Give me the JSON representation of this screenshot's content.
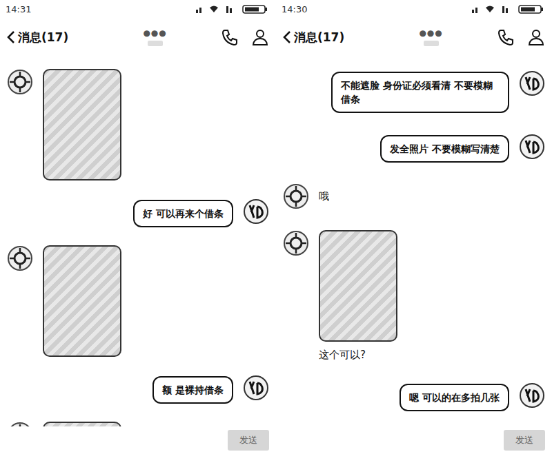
{
  "panels": [
    {
      "status_time": "14:31",
      "header": {
        "back": "消息(17)",
        "title": "●●●"
      },
      "messages": [
        {
          "side": "in",
          "kind": "image",
          "text": ""
        },
        {
          "side": "out",
          "kind": "text",
          "text": "好 可以再来个借条"
        },
        {
          "side": "in",
          "kind": "image",
          "text": ""
        },
        {
          "side": "out",
          "kind": "text",
          "text": "额 是裸持借条"
        },
        {
          "side": "in",
          "kind": "image",
          "text": ""
        }
      ],
      "send": "发送"
    },
    {
      "status_time": "14:30",
      "header": {
        "back": "消息(17)",
        "title": "●●●"
      },
      "messages": [
        {
          "side": "out",
          "kind": "text",
          "text": "不能遮脸 身份证必须看清 不要模糊借条"
        },
        {
          "side": "out",
          "kind": "text",
          "text": "发全照片 不要模糊写清楚"
        },
        {
          "side": "in",
          "kind": "text",
          "text": "哦"
        },
        {
          "side": "in",
          "kind": "image_text",
          "text": "这个可以?"
        },
        {
          "side": "out",
          "kind": "text",
          "text": "嗯 可以的在多拍几张"
        }
      ],
      "send": "发送"
    }
  ]
}
